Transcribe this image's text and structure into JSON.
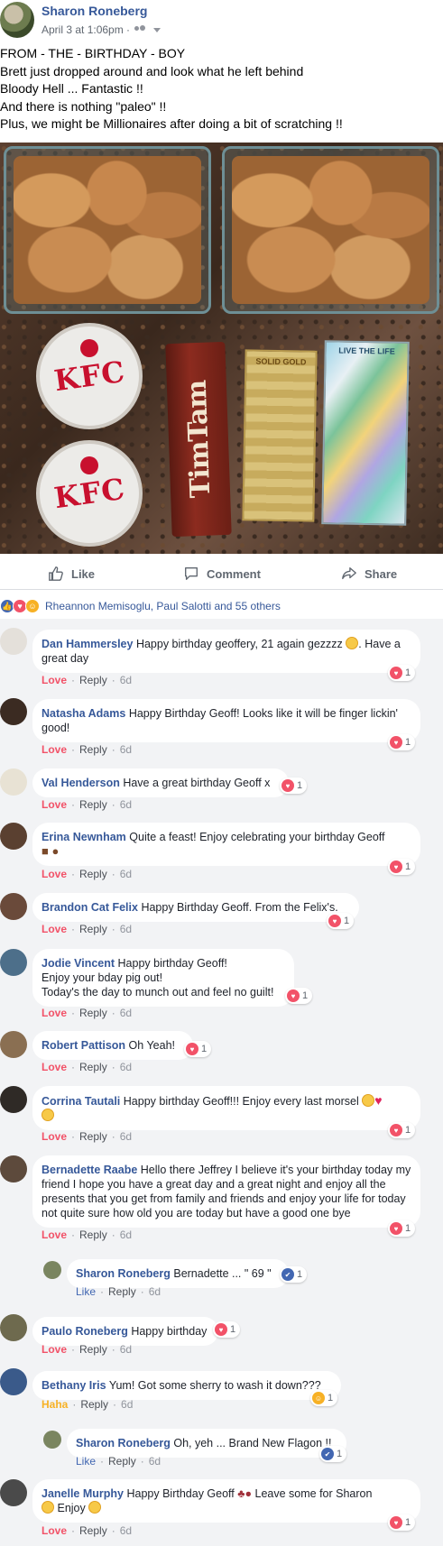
{
  "post": {
    "author": "Sharon Roneberg",
    "date": "April 3 at 1:06pm ·",
    "lines": [
      "FROM - THE - BIRTHDAY - BOY",
      "Brett just dropped around and look what he left behind",
      "Bloody Hell ... Fantastic !!",
      "And there is nothing \"paleo\" !!",
      "Plus, we might be Millionaires after doing a bit of scratching !!"
    ],
    "photo_labels": {
      "kfc": "KFC",
      "timtam": "TimTam",
      "ticket1": "SOLID GOLD",
      "ticket2": "LIVE THE LIFE"
    }
  },
  "actions": {
    "like": "Like",
    "comment": "Comment",
    "share": "Share"
  },
  "reactions_summary": "Rheannon Memisoglu, Paul Salotti and 55 others",
  "comments": [
    {
      "name": "Dan Hammersley",
      "text": "Happy birthday geoffery, 21 again gezzzz",
      "text2": ". Have a great day",
      "reaction": "Love",
      "reply": "Reply",
      "time": "6d",
      "count": "1"
    },
    {
      "name": "Natasha Adams",
      "text": "Happy Birthday Geoff! Looks like it will be finger lickin' good!",
      "reaction": "Love",
      "reply": "Reply",
      "time": "6d",
      "count": "1"
    },
    {
      "name": "Val Henderson",
      "text": "Have a great birthday Geoff x",
      "reaction": "Love",
      "reply": "Reply",
      "time": "6d",
      "count": "1"
    },
    {
      "name": "Erina Newnham",
      "text": "Quite a feast! Enjoy celebrating your birthday Geoff",
      "reaction": "Love",
      "reply": "Reply",
      "time": "6d",
      "count": "1"
    },
    {
      "name": "Brandon Cat Felix",
      "text": "Happy Birthday Geoff. From the Felix's.",
      "reaction": "Love",
      "reply": "Reply",
      "time": "6d",
      "count": "1"
    },
    {
      "name": "Jodie Vincent",
      "text": "Happy birthday Geoff!",
      "text2": "Enjoy your bday pig out!",
      "text3": "Today's the day to munch out and feel no guilt!",
      "reaction": "Love",
      "reply": "Reply",
      "time": "6d",
      "count": "1"
    },
    {
      "name": "Robert Pattison",
      "text": "Oh Yeah!",
      "reaction": "Love",
      "reply": "Reply",
      "time": "6d",
      "count": "1"
    },
    {
      "name": "Corrina Tautali",
      "text": "Happy birthday Geoff!!! Enjoy every last morsel",
      "reaction": "Love",
      "reply": "Reply",
      "time": "6d",
      "count": "1"
    },
    {
      "name": "Bernadette Raabe",
      "text": "Hello there Jeffrey I believe it's your birthday today my friend I hope you have a great day and a great night and enjoy all the presents that you get from family and friends and enjoy your life for today not quite sure how old you are today but have a good one bye",
      "reaction": "Love",
      "reply": "Reply",
      "time": "6d",
      "count": "1"
    },
    {
      "name": "Sharon Roneberg",
      "text": "Bernadette ... \" 69 \"",
      "reaction": "Like",
      "reply": "Reply",
      "time": "6d",
      "count": "1"
    },
    {
      "name": "Paulo Roneberg",
      "text": "Happy birthday",
      "reaction": "Love",
      "reply": "Reply",
      "time": "6d",
      "count": "1"
    },
    {
      "name": "Bethany Iris",
      "text": "Yum! Got some sherry to wash it down???",
      "reaction": "Haha",
      "reply": "Reply",
      "time": "6d",
      "count": "1"
    },
    {
      "name": "Sharon Roneberg",
      "text": "Oh, yeh ... Brand New Flagon !!",
      "reaction": "Like",
      "reply": "Reply",
      "time": "6d",
      "count": "1"
    },
    {
      "name": "Janelle Murphy",
      "text": "Happy Birthday Geoff",
      "text2": "Leave some for Sharon",
      "text3": "Enjoy",
      "reaction": "Love",
      "reply": "Reply",
      "time": "6d",
      "count": "1"
    }
  ],
  "colors": {
    "link": "#365899",
    "love": "#f25268",
    "like": "#4267b2",
    "haha": "#f7b125",
    "comments_bg": "#f2f3f5"
  }
}
